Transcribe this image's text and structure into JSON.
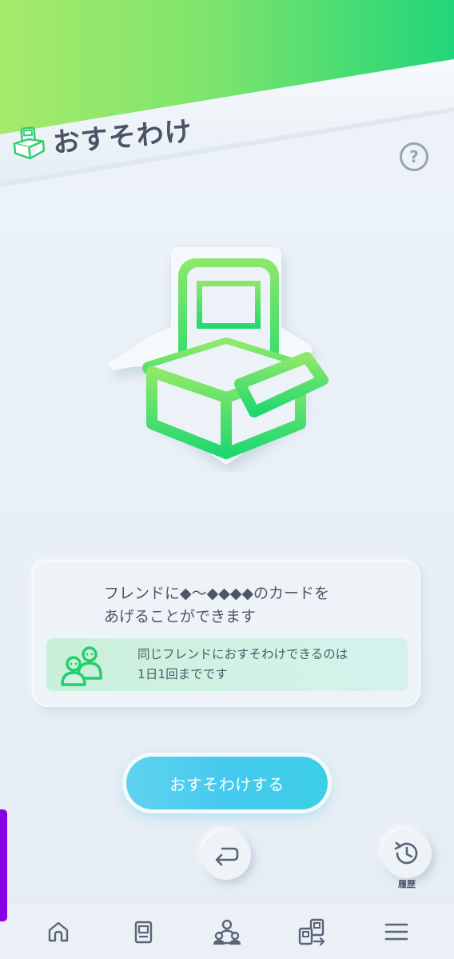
{
  "header": {
    "title": "おすそわけ",
    "help_symbol": "?",
    "brand_gradient": [
      "#9ee86a",
      "#2ed874"
    ]
  },
  "hero": {
    "icon": "box-with-card-icon",
    "accent_color": "#3ee07a"
  },
  "info": {
    "line1": "フレンドに◆〜◆◆◆◆のカードを",
    "line2": "あげることができます",
    "notice_icon": "friends-icon",
    "notice_line1": "同じフレンドにおすそわけできるのは",
    "notice_line2": "1日1回までです"
  },
  "actions": {
    "share_label": "おすそわけする",
    "share_color": "#45c9ef",
    "back_icon": "return-arrow-icon",
    "history_icon": "history-clock-icon",
    "history_label": "履歴"
  },
  "bottom_nav": {
    "items": [
      {
        "icon": "home-icon"
      },
      {
        "icon": "card-binder-icon"
      },
      {
        "icon": "social-icon"
      },
      {
        "icon": "card-trade-icon"
      },
      {
        "icon": "menu-icon"
      }
    ]
  }
}
